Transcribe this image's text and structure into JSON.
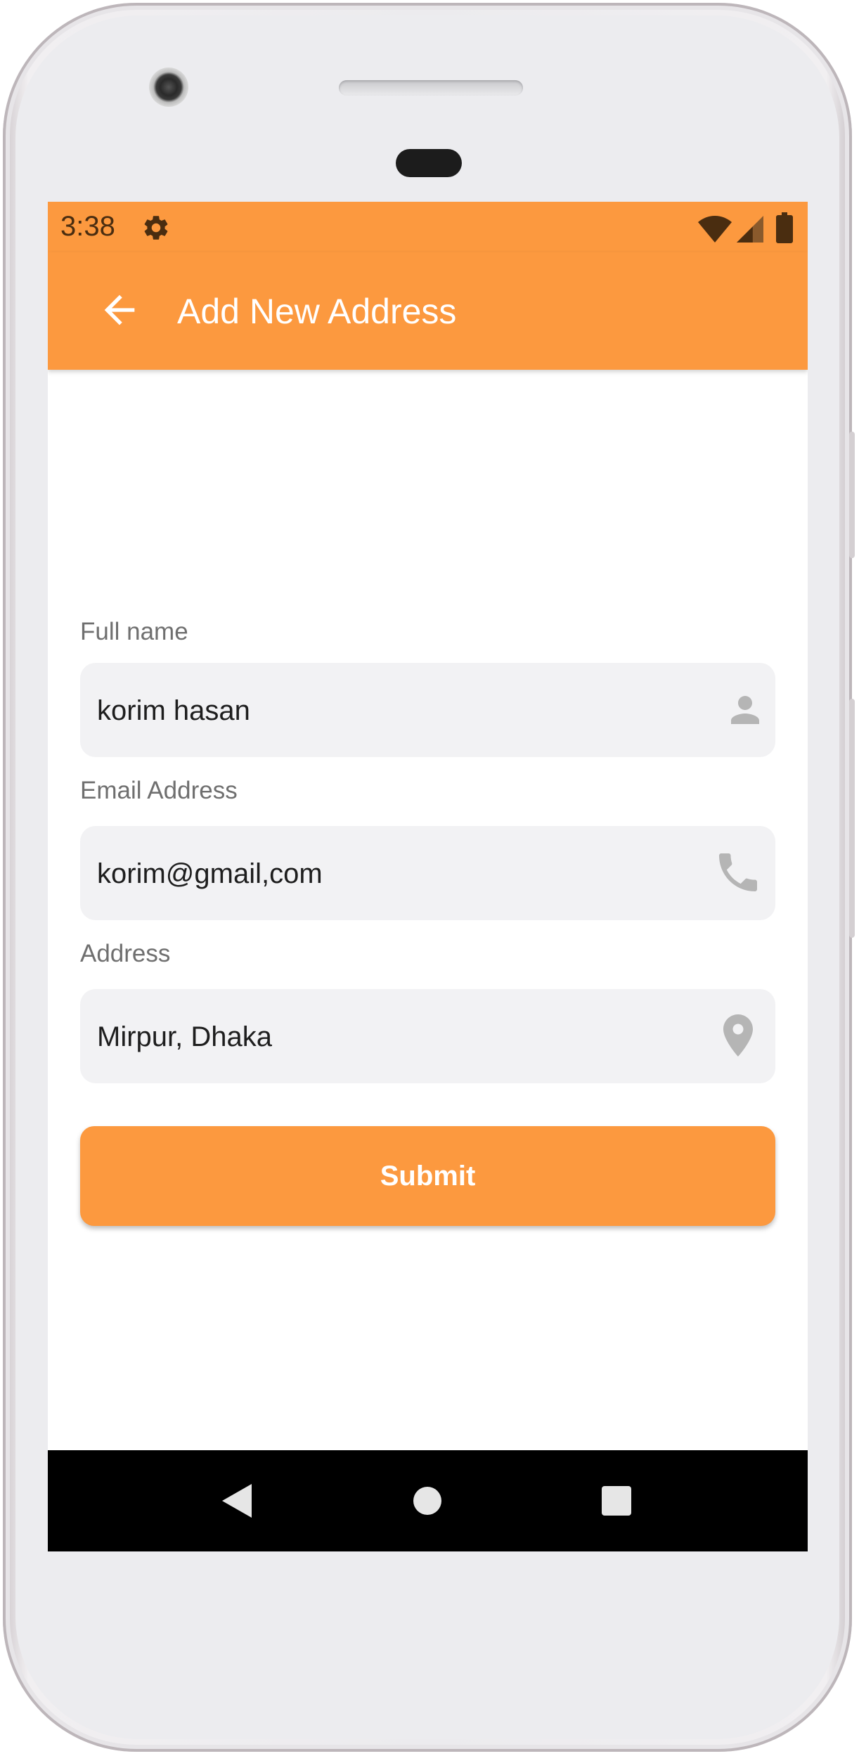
{
  "colors": {
    "accent": "#fc993f",
    "status_text": "#4a2d10",
    "field_bg": "#f2f2f4",
    "label_text": "#6f6f6f",
    "icon_gray": "#b5b5b5",
    "nav_bar": "#000000"
  },
  "status_bar": {
    "time": "3:38",
    "icons": [
      "settings-gear-icon",
      "wifi-icon",
      "cell-signal-icon",
      "battery-icon"
    ]
  },
  "app_bar": {
    "back_icon": "arrow-back-icon",
    "title": "Add New Address"
  },
  "form": {
    "full_name": {
      "label": "Full name",
      "value": "korim hasan",
      "icon": "person-icon"
    },
    "email": {
      "label": "Email Address",
      "value": "korim@gmail,com",
      "icon": "phone-icon"
    },
    "address": {
      "label": "Address",
      "value": "Mirpur, Dhaka",
      "icon": "location-pin-icon"
    },
    "submit_label": "Submit"
  },
  "nav_bar": {
    "buttons": [
      "nav-back-icon",
      "nav-home-icon",
      "nav-recents-icon"
    ]
  }
}
